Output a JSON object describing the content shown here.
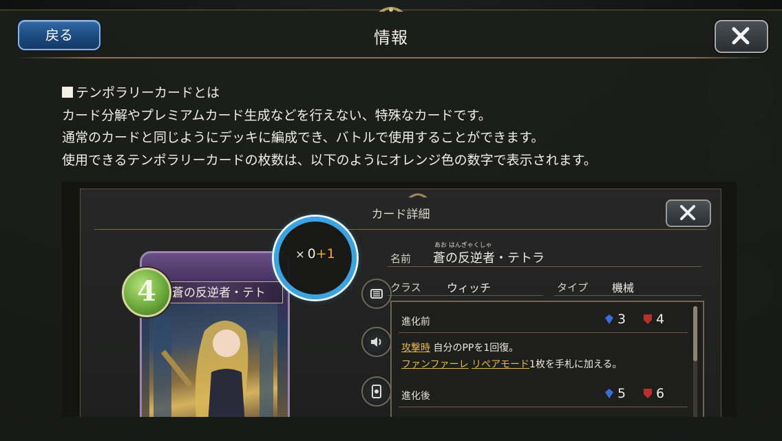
{
  "header": {
    "title": "情報",
    "back_label": "戻る"
  },
  "content": {
    "lines": [
      "テンポラリーカードとは",
      "カード分解やプレミアムカード生成などを行えない、特殊なカードです。",
      "通常のカードと同じようにデッキに編成でき、バトルで使用することができます。",
      "使用できるテンポラリーカードの枚数は、以下のようにオレンジ色の数字で表示されます。"
    ]
  },
  "example": {
    "title": "カード詳細",
    "card": {
      "cost": "4",
      "name_on_card": "蒼の反逆者・テト"
    },
    "count_badge": {
      "prefix": "×",
      "base": "0",
      "temporary": "+1"
    },
    "fields": {
      "name_label": "名前",
      "name_value": "蒼の反逆者・テトラ",
      "name_ruby": "あお はんぎゃくしゃ",
      "class_label": "クラス",
      "class_value": "ウィッチ",
      "type_label": "タイプ",
      "type_value": "機械"
    },
    "before_evolve": {
      "label": "進化前",
      "attack": "3",
      "defense": "4",
      "line1_keyword": "攻撃時",
      "line1_text": "自分のPPを1回復。",
      "line2_keyword_a": "ファンファーレ",
      "line2_keyword_b": "リペアモード",
      "line2_text": "1枚を手札に加える。"
    },
    "after_evolve": {
      "label": "進化後",
      "attack": "5",
      "defense": "6"
    }
  },
  "colors": {
    "accent_blue": "#3aa3e0",
    "temporary_orange": "#f0a63a",
    "keyword_gold": "#e9b84b"
  }
}
